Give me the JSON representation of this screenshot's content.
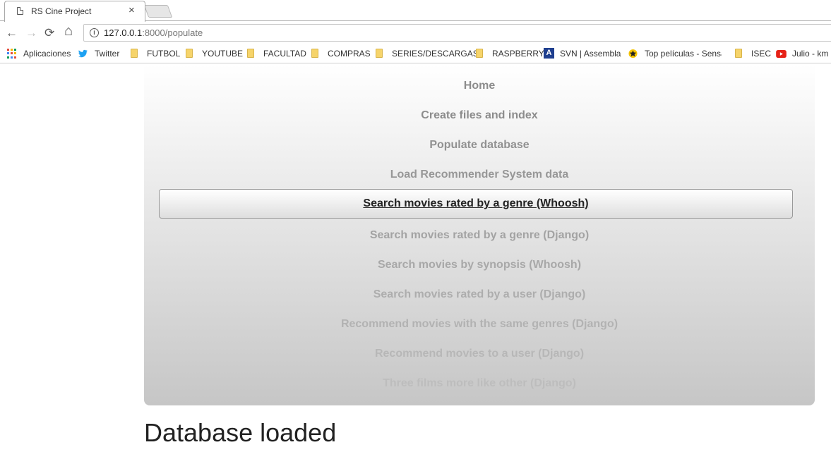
{
  "browser": {
    "tab": {
      "title": "RS Cine Project",
      "close": "×"
    },
    "toolbar": {
      "back": "←",
      "forward": "→",
      "reload": "⟳",
      "home": "⌂",
      "info": "i",
      "url_host": "127.0.0.1",
      "url_rest": ":8000/populate"
    },
    "bookmarks": [
      {
        "label": "Aplicaciones",
        "icon": "apps-grid-icon"
      },
      {
        "label": "Twitter",
        "icon": "twitter-bird-icon"
      },
      {
        "label": "FUTBOL",
        "icon": "folder-icon"
      },
      {
        "label": "YOUTUBE",
        "icon": "folder-icon"
      },
      {
        "label": "FACULTAD",
        "icon": "folder-icon"
      },
      {
        "label": "COMPRAS",
        "icon": "folder-icon"
      },
      {
        "label": "SERIES/DESCARGAS",
        "icon": "folder-icon"
      },
      {
        "label": "RASPBERRY",
        "icon": "folder-icon"
      },
      {
        "label": "SVN | Assembla",
        "icon": "assembla-icon"
      },
      {
        "label": "Top películas - Sensac",
        "icon": "sensacine-icon"
      },
      {
        "label": "ISEC",
        "icon": "folder-icon"
      },
      {
        "label": "Julio - km",
        "icon": "youtube-icon"
      }
    ]
  },
  "nav": {
    "items": [
      {
        "label": "Home",
        "color": "#8c8c8c"
      },
      {
        "label": "Create files and index",
        "color": "#8c8c8c"
      },
      {
        "label": "Populate database",
        "color": "#919191"
      },
      {
        "label": "Load Recommender System data",
        "color": "#979797"
      },
      {
        "label": "Search movies rated by a genre (Whoosh)",
        "color": "#222222",
        "active": true
      },
      {
        "label": "Search movies rated by a genre (Django)",
        "color": "#a3a3a3"
      },
      {
        "label": "Search movies by synopsis (Whoosh)",
        "color": "#a8a8a8"
      },
      {
        "label": "Search movies rated by a user (Django)",
        "color": "#adadad"
      },
      {
        "label": "Recommend movies with the same genres (Django)",
        "color": "#b2b2b2"
      },
      {
        "label": "Recommend movies to a user (Django)",
        "color": "#b7b7b7"
      },
      {
        "label": "Three films more like other (Django)",
        "color": "#bdbdbd"
      }
    ]
  },
  "main": {
    "heading": "Database loaded"
  },
  "colors": {
    "twitter": "#1da1f2",
    "youtube": "#e62117",
    "assembla": "#1f3f8f"
  }
}
